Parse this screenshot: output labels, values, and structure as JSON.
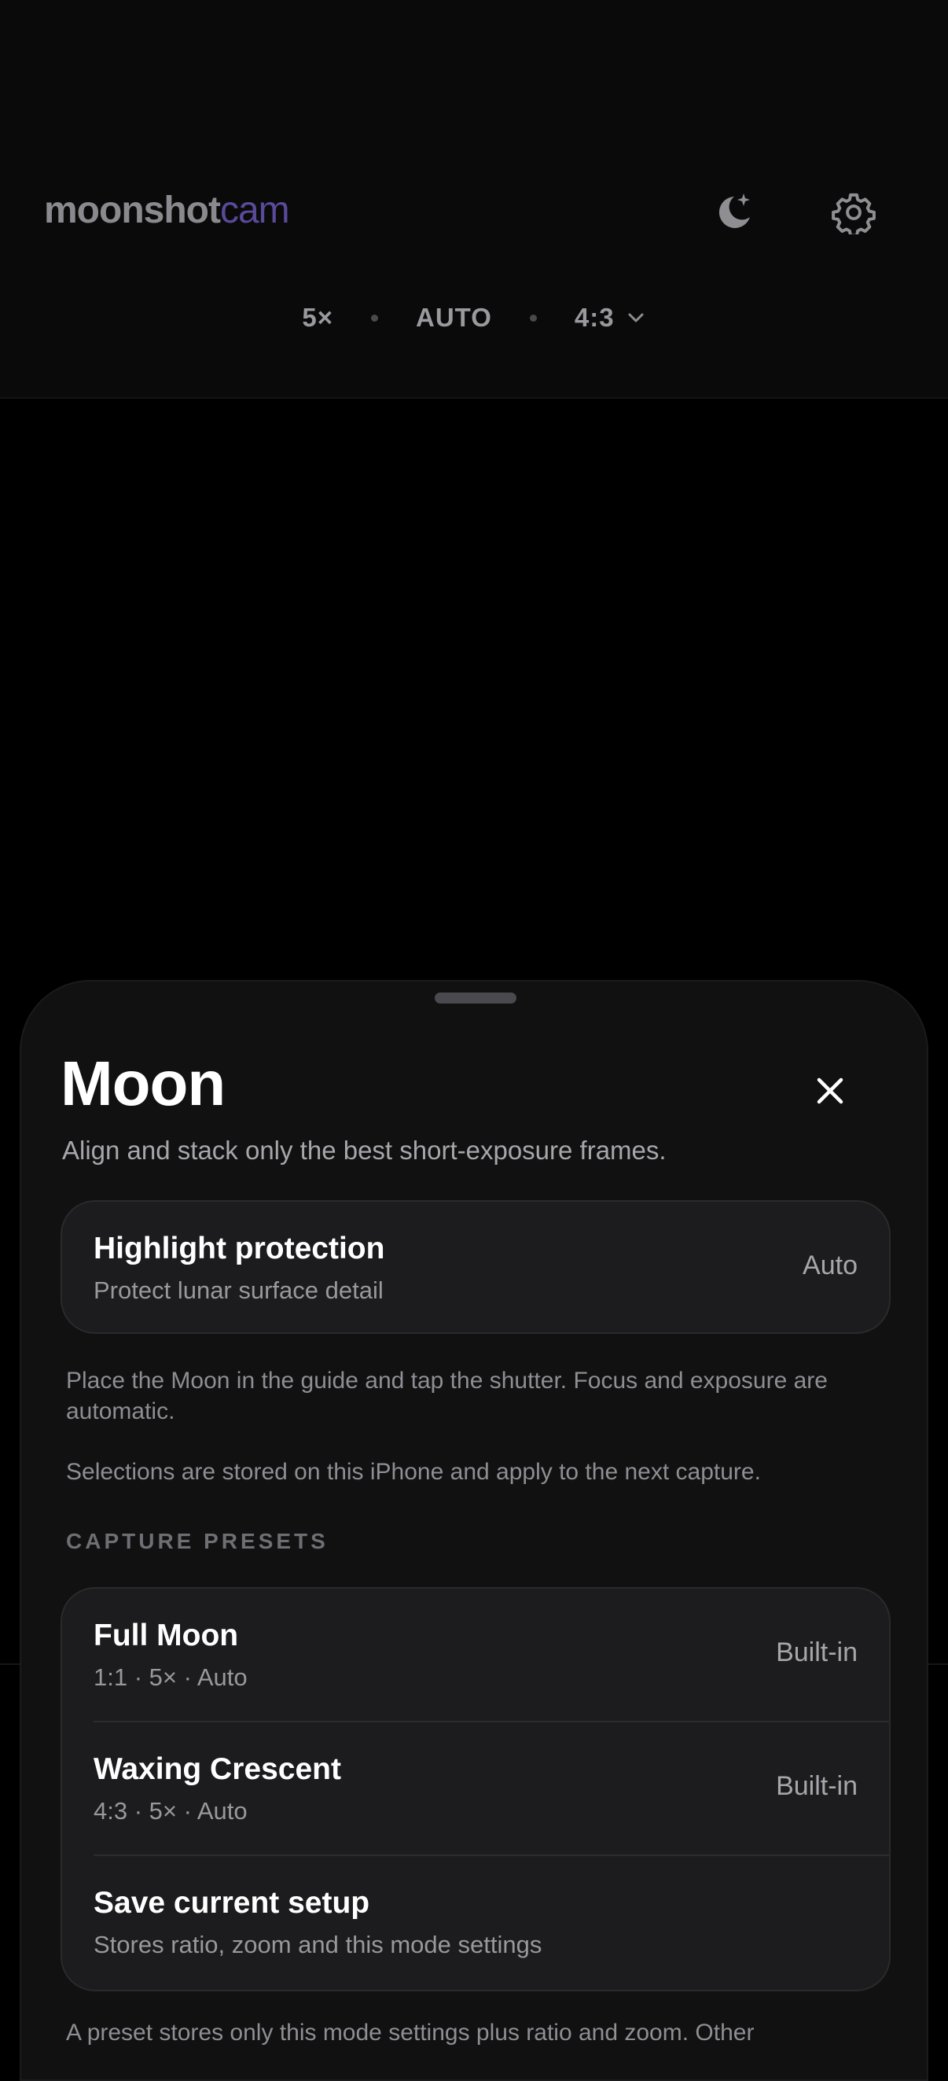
{
  "header": {
    "brand_primary": "moonshot",
    "brand_accent": "cam",
    "moon_icon": "moon-stars-icon",
    "settings_icon": "gear-icon"
  },
  "capture_settings": {
    "zoom": "5×",
    "exposure": "AUTO",
    "ratio": "4:3",
    "ratio_icon": "chevron-down-icon"
  },
  "sheet": {
    "title": "Moon",
    "subtitle": "Align and stack only the best short-exposure frames.",
    "close_icon": "close-icon",
    "highlight": {
      "title": "Highlight protection",
      "description": "Protect lunar surface detail",
      "value": "Auto"
    },
    "info_placement": "Place the Moon in the guide and tap the shutter. Focus and exposure are automatic.",
    "info_storage": "Selections are stored on this iPhone and apply to the next capture.",
    "presets_label": "CAPTURE PRESETS",
    "presets": [
      {
        "title": "Full Moon",
        "description": "1:1 · 5× · Auto",
        "value": "Built-in"
      },
      {
        "title": "Waxing Crescent",
        "description": "4:3 · 5× · Auto",
        "value": "Built-in"
      },
      {
        "title": "Save current setup",
        "description": "Stores ratio, zoom and this mode settings",
        "value": ""
      }
    ],
    "footnote": "A preset stores only this mode settings plus ratio and zoom. Other"
  },
  "colors": {
    "background": "#000000",
    "sheet": "#111112",
    "card": "#1c1c1e",
    "brand_accent": "#5a4a9a"
  }
}
